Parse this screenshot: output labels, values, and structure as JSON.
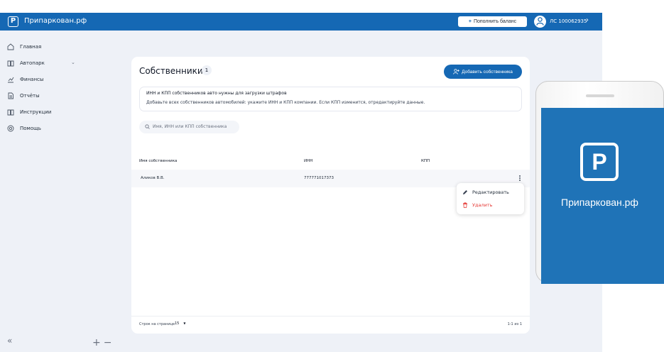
{
  "header": {
    "logo_letter": "P",
    "brand": "Припаркован.рф",
    "topup_label": "Пополнить баланс",
    "account": "ЛС 100062935"
  },
  "sidebar": {
    "items": [
      {
        "label": "Главная",
        "icon": "home-icon"
      },
      {
        "label": "Автопарк",
        "icon": "book-icon"
      },
      {
        "label": "Финансы",
        "icon": "chart-icon"
      },
      {
        "label": "Отчёты",
        "icon": "document-icon"
      },
      {
        "label": "Инструкции",
        "icon": "book-icon"
      },
      {
        "label": "Помощь",
        "icon": "help-icon"
      }
    ],
    "collapse_glyph": "«",
    "zoom_glyph": "+−"
  },
  "main": {
    "title": "Собственники",
    "count": "1",
    "add_label": "Добавить собственника",
    "info_title": "ИНН и КПП собственников авто нужны для загрузки штрафов",
    "info_text": "Добавьте всех собственников автомобилей: укажите ИНН и КПП компании. Если КПП изменится, отредактируйте данные.",
    "search_placeholder": "Имя, ИНН или КПП собственника",
    "columns": [
      "Имя собственника",
      "ИНН",
      "КПП"
    ],
    "rows": [
      {
        "name": "Аликов В.В.",
        "inn": "777771017373",
        "kpp": ""
      }
    ],
    "menu": {
      "edit": "Редактировать",
      "delete": "Удалить"
    },
    "footer": {
      "rows_label": "Строк на странице",
      "rows_value": "15",
      "pager": "1-1 из 1"
    }
  },
  "phone": {
    "logo_letter": "P",
    "brand": "Припаркован.рф"
  },
  "colors": {
    "accent": "#1568b4",
    "danger": "#e53935",
    "background": "#eef1f7"
  }
}
